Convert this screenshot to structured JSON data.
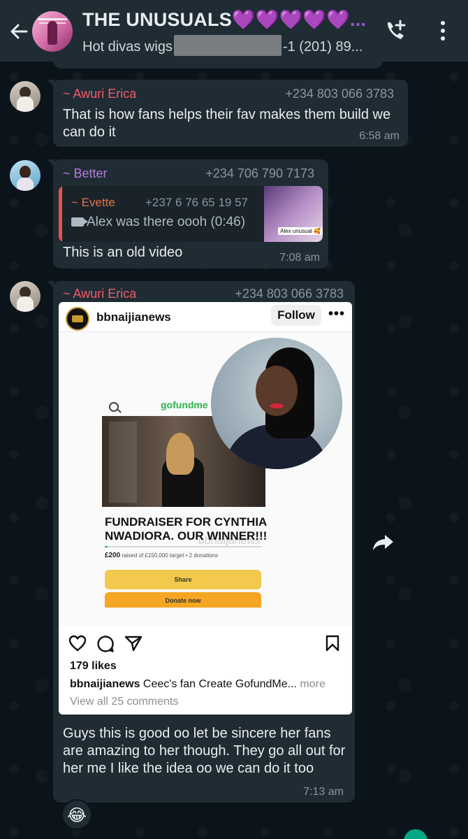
{
  "header": {
    "title": "THE UNUSUALS",
    "title_emojis": "💜💜💜💜💜...",
    "subtitle_before": "Hot divas wigs",
    "subtitle_after": "-1 (201) 89...",
    "icons": {
      "back": "arrow-left-icon",
      "call": "add-call-icon",
      "menu": "more-vert-icon"
    }
  },
  "previous": {
    "time": ""
  },
  "messages": [
    {
      "sender": "~ Awuri Erica",
      "sender_color": "#f15c6d",
      "phone": "+234 803 066 3783",
      "text": "That is how fans helps their fav makes them build we can do it",
      "time": "6:58 am"
    },
    {
      "sender": "~ Better",
      "sender_color": "#b27ee0",
      "phone": "+234 706 790 7173",
      "quote": {
        "sender": "~ Evette",
        "phone": "+237 6 76 65 19 57",
        "text": "Alex was there oooh (0:46)",
        "thumb_caption": "Alex unusual 🥰"
      },
      "text": "This is an old video",
      "time": "7:08 am"
    },
    {
      "sender": "~ Awuri Erica",
      "sender_color": "#f15c6d",
      "phone": "+234 803 066 3783",
      "instagram": {
        "username": "bbnaijianews",
        "follow_label": "Follow",
        "more_label": "•••",
        "gofundme_logo": "gofundme",
        "fundraiser_title": "FUNDRAISER FOR CYNTHIA NWADIORA. OUR WINNER!!!",
        "raised_amount": "£200",
        "raised_text": "raised of £150,000 target • 2 donations",
        "progress_fraction": 0.01,
        "watermark": "bbnaijanews",
        "share_label": "Share",
        "donate_label": "Donate now",
        "likes": "179 likes",
        "caption_user": "bbnaijianews",
        "caption_text": "Ceec's fan Create GofundMe...",
        "caption_more": "more",
        "comments_link": "View all 25 comments"
      },
      "text": "Guys this is good oo let be sincere her fans are amazing to her though. They go all out for her me I like the idea oo we can do it too",
      "time": "7:13 am",
      "reaction": "😂"
    }
  ]
}
